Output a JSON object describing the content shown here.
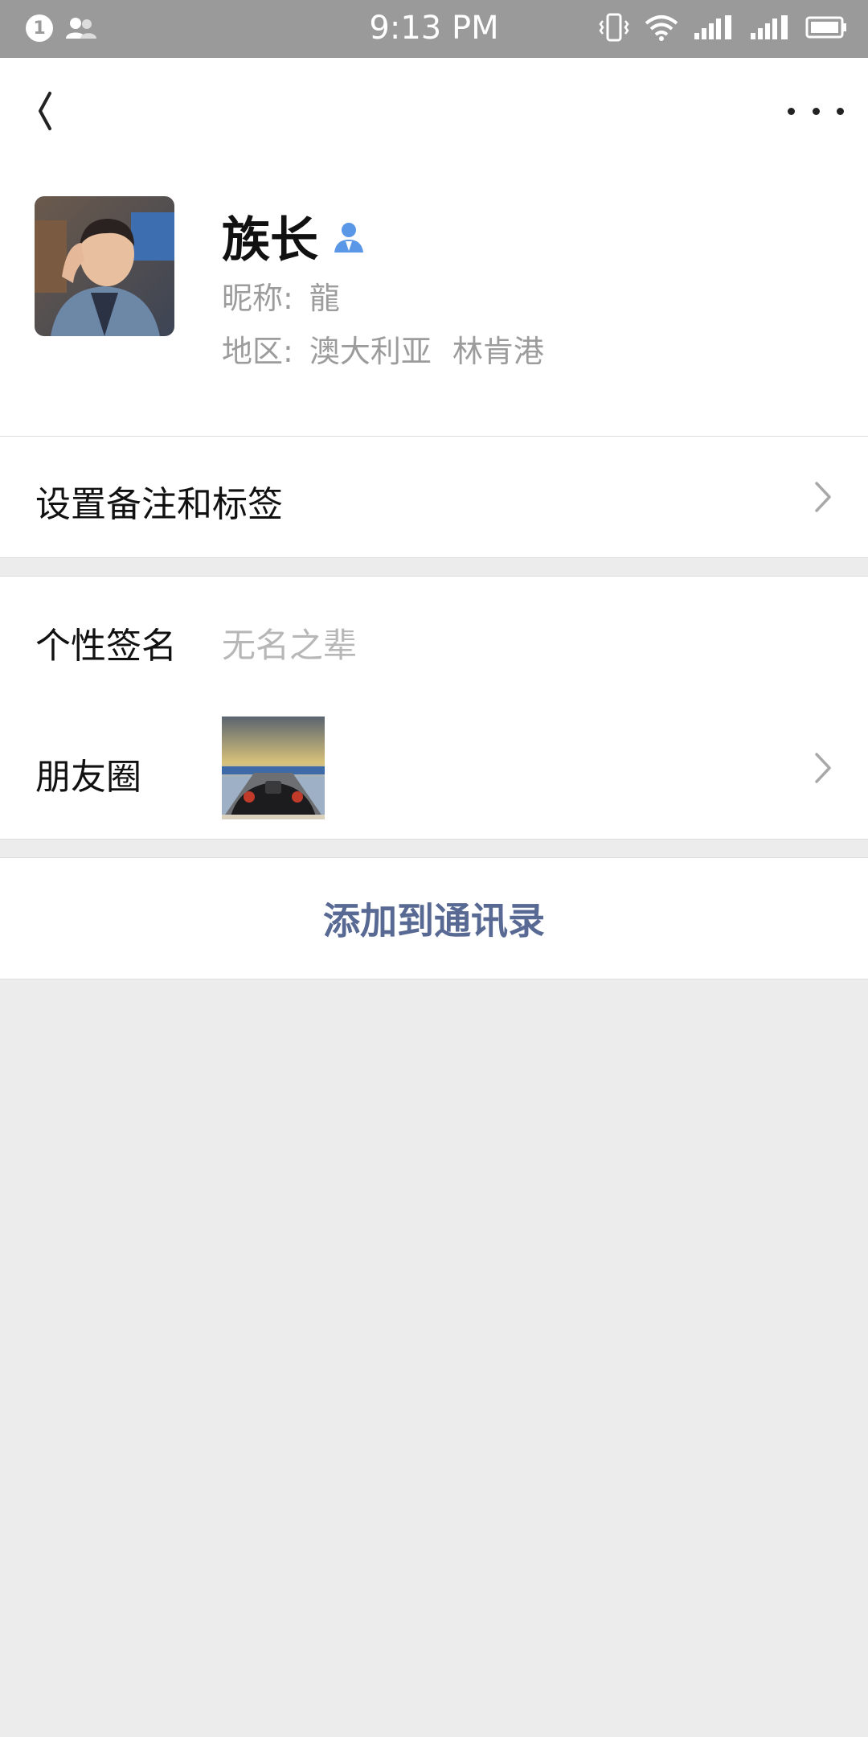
{
  "status_bar": {
    "notification_count": "1",
    "time": "9:13 PM"
  },
  "profile": {
    "name": "族长",
    "nickname_label": "昵称:",
    "nickname_value": "龍",
    "region_label": "地区:",
    "region_country": "澳大利亚",
    "region_city": "林肯港"
  },
  "rows": {
    "remark_label": "设置备注和标签",
    "signature_label": "个性签名",
    "signature_value": "无名之辈",
    "moments_label": "朋友圈"
  },
  "add_contact_label": "添加到通讯录",
  "icons": {
    "back": "back-chevron-icon",
    "more": "more-dots-icon",
    "verified": "person-icon",
    "chevron": "chevron-right-icon"
  },
  "colors": {
    "status_bar_bg": "#9a9a9a",
    "accent_link": "#586a94",
    "verified_blue": "#5a97e6",
    "secondary_text": "#9c9c9c",
    "background": "#ececec"
  }
}
